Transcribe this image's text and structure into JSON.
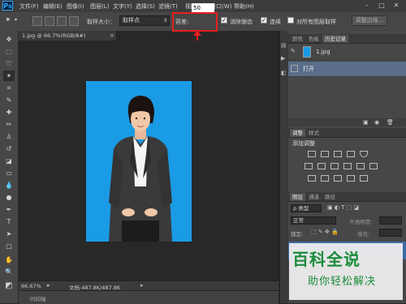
{
  "app": {
    "logo": "Ps"
  },
  "menu": [
    "文件(F)",
    "编辑(E)",
    "图像(I)",
    "图层(L)",
    "文字(Y)",
    "选择(S)",
    "滤镜(T)",
    "视图(V)",
    "窗口(W)",
    "帮助(H)"
  ],
  "window_controls": [
    "–",
    "□",
    "✕"
  ],
  "options": {
    "sample_size_label": "取样大小：",
    "sample_size_value": "取样点",
    "tolerance_label": "容差:",
    "tolerance_value": "50",
    "anti_alias": "消除锯齿",
    "contiguous": "连续",
    "sample_all_layers": "对所有图层取样",
    "refine_edge": "调整边缘..."
  },
  "document": {
    "tab_title": "1.jpg @ 66.7%(RGB/8#)",
    "close": "×"
  },
  "status": {
    "zoom": "66.67%",
    "doc_size": "文档:487.8K/487.8K"
  },
  "timeline_label": "时间轴",
  "history_panel": {
    "tabs": [
      "颜色",
      "色板",
      "历史记录"
    ],
    "active_tab": "历史记录",
    "snapshot_label": "1.jpg",
    "step": "打开"
  },
  "adjustments_panel": {
    "tabs": [
      "调整",
      "样式"
    ],
    "active_tab": "调整",
    "title": "添加调整"
  },
  "layers_panel": {
    "tabs": [
      "图层",
      "通道",
      "路径"
    ],
    "active_tab": "图层",
    "filter_label": "ρ 类型",
    "blend_mode": "正常",
    "opacity_label": "不透明度:",
    "lock_label": "锁定:",
    "fill_label": "填充:"
  },
  "watermark": {
    "title": "百科全说",
    "subtitle": "助你轻松解决"
  },
  "colors": {
    "highlight_box": "#e81d1d",
    "photo_bg": "#1a9be6",
    "watermark_green": "#1a8c3c"
  }
}
